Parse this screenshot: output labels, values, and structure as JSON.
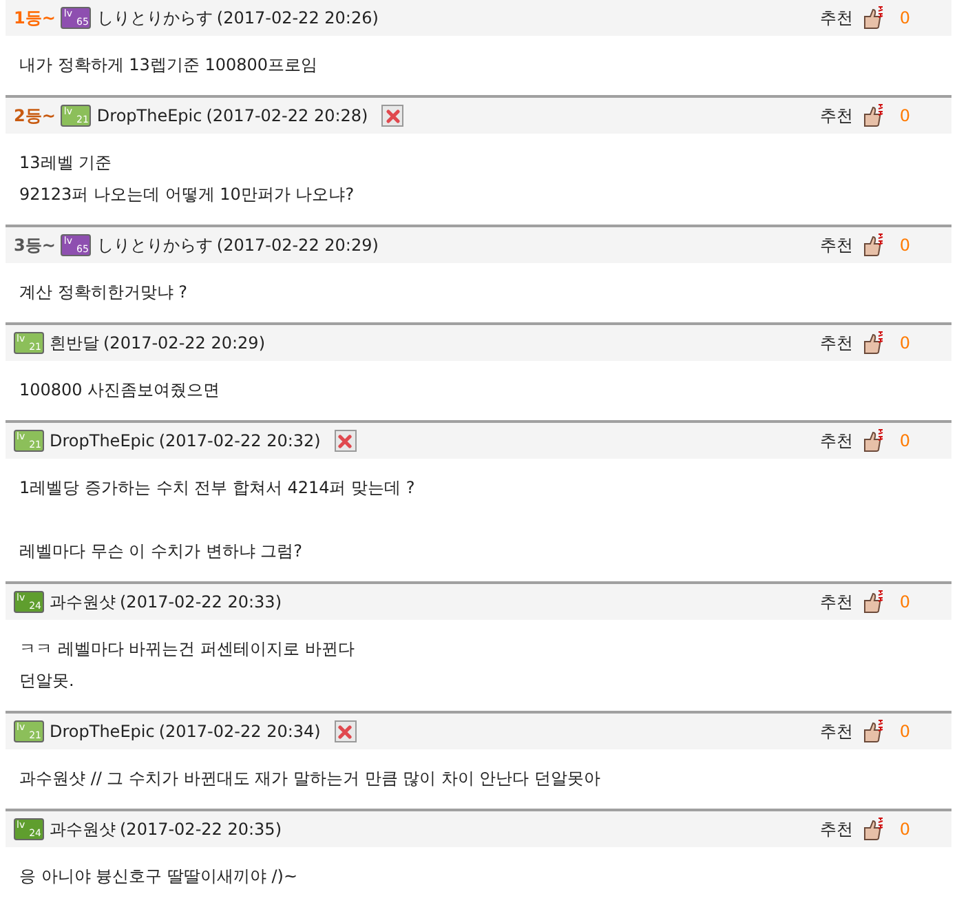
{
  "comments": [
    {
      "rank": {
        "text": "1등~",
        "color": "#ff6a00"
      },
      "badge": {
        "prefix": "lv",
        "level": "65",
        "color": "#8e4fb0"
      },
      "author": "しりとりからす",
      "time": "(2017-02-22 20:26)",
      "deletable": false,
      "recommend_label": "추천",
      "recommend_count": "0",
      "paragraphs": [
        [
          "내가 정확하게 13렙기준 100800프로임"
        ]
      ]
    },
    {
      "rank": {
        "text": "2등~",
        "color": "#c85a10"
      },
      "badge": {
        "prefix": "lv",
        "level": "21",
        "color": "#8cbf5a"
      },
      "author": "DropTheEpic",
      "time": "(2017-02-22 20:28)",
      "deletable": true,
      "recommend_label": "추천",
      "recommend_count": "0",
      "paragraphs": [
        [
          "13레벨 기준",
          "92123퍼 나오는데 어떻게 10만퍼가 나오냐?"
        ]
      ]
    },
    {
      "rank": {
        "text": "3등~",
        "color": "#555555"
      },
      "badge": {
        "prefix": "lv",
        "level": "65",
        "color": "#8e4fb0"
      },
      "author": "しりとりからす",
      "time": "(2017-02-22 20:29)",
      "deletable": false,
      "recommend_label": "추천",
      "recommend_count": "0",
      "paragraphs": [
        [
          "계산 정확히한거맞냐 ?"
        ]
      ]
    },
    {
      "badge": {
        "prefix": "lv",
        "level": "21",
        "color": "#8cbf5a"
      },
      "author": "흰반달",
      "time": "(2017-02-22 20:29)",
      "deletable": false,
      "recommend_label": "추천",
      "recommend_count": "0",
      "paragraphs": [
        [
          "100800 사진좀보여줬으면"
        ]
      ]
    },
    {
      "badge": {
        "prefix": "lv",
        "level": "21",
        "color": "#8cbf5a"
      },
      "author": "DropTheEpic",
      "time": "(2017-02-22 20:32)",
      "deletable": true,
      "recommend_label": "추천",
      "recommend_count": "0",
      "paragraphs": [
        [
          "1레벨당 증가하는 수치 전부 합쳐서 4214퍼 맞는데 ?"
        ],
        [
          "레벨마다 무슨 이 수치가 변하냐 그럼?"
        ]
      ]
    },
    {
      "badge": {
        "prefix": "lv",
        "level": "24",
        "color": "#5f9e2e"
      },
      "author": "과수원샷",
      "time": "(2017-02-22 20:33)",
      "deletable": false,
      "recommend_label": "추천",
      "recommend_count": "0",
      "paragraphs": [
        [
          "ㅋㅋ 레벨마다 바뀌는건 퍼센테이지로 바뀐다",
          "던알못."
        ]
      ]
    },
    {
      "badge": {
        "prefix": "lv",
        "level": "21",
        "color": "#8cbf5a"
      },
      "author": "DropTheEpic",
      "time": "(2017-02-22 20:34)",
      "deletable": true,
      "recommend_label": "추천",
      "recommend_count": "0",
      "paragraphs": [
        [
          "과수원샷 // 그 수치가 바뀐대도 재가 말하는거 만큼 많이 차이 안난다 던알못아"
        ]
      ]
    },
    {
      "badge": {
        "prefix": "lv",
        "level": "24",
        "color": "#5f9e2e"
      },
      "author": "과수원샷",
      "time": "(2017-02-22 20:35)",
      "deletable": false,
      "recommend_label": "추천",
      "recommend_count": "0",
      "paragraphs": [
        [
          "응 아니야 븅신호구 딸딸이새끼야 /)~"
        ]
      ]
    }
  ]
}
